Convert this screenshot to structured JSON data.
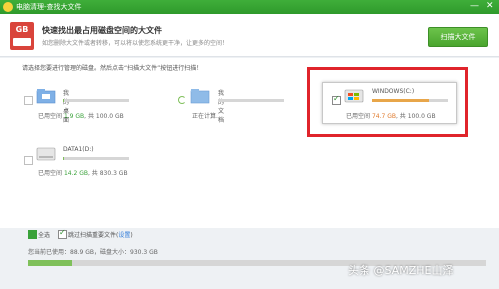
{
  "window": {
    "title": "电脑清理-查找大文件",
    "controls": [
      "—",
      "✕"
    ]
  },
  "header": {
    "icon_text": "GB",
    "headline": "快速找出最占用磁盘空间的大文件",
    "subline": "如您删除大文件或者转移，可以将以使您系统更干净，让更多的空间！",
    "scan_button": "扫描大文件"
  },
  "instruction": "请选择您要进行管理的磁盘。然后点击“扫描大文件”按钮进行扫描！",
  "drives": [
    {
      "name": "我的桌面",
      "used_prefix": "已用空间",
      "used": "1.9 GB",
      "total_text": ", 共 100.0 GB",
      "checked": false,
      "fill": 0.02,
      "icon": "desktop-folder-icon"
    },
    {
      "name": "我的文档",
      "used_prefix": "正在计算...",
      "used": "",
      "total_text": "",
      "checked": false,
      "fill": 0.0,
      "icon": "documents-folder-icon"
    },
    {
      "name": "WINDOWS(C:)",
      "used_prefix": "已用空间",
      "used": "74.7 GB",
      "total_text": ", 共 100.0 GB",
      "checked": true,
      "fill": 0.747,
      "icon": "windows-drive-icon"
    },
    {
      "name": "DATA1(D:)",
      "used_prefix": "已用空间",
      "used": "14.2 GB",
      "total_text": ", 共 830.3 GB",
      "checked": false,
      "fill": 0.017,
      "icon": "hard-drive-icon"
    }
  ],
  "footer": {
    "select_all": "全选",
    "skip_label": "跳过扫描重要文件(",
    "skip_link": "设置",
    "skip_close": ")",
    "total_text": "您当前已使用：88.9 GB，磁盘大小：930.3 GB",
    "total_fill": 0.096
  },
  "watermark": "头条 @SAMZHE山泽",
  "colors": {
    "accent_green": "#3aa23a",
    "usage_orange": "#e07a2b",
    "highlight_red": "#e0242b"
  }
}
